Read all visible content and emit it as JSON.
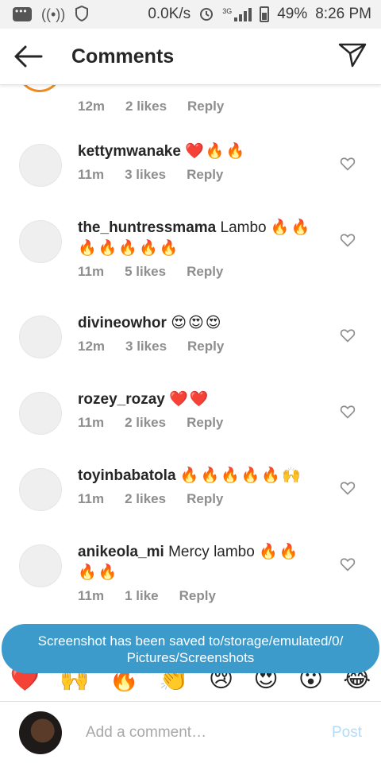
{
  "status_bar": {
    "speed": "0.0K/s",
    "network": "3G",
    "battery": "49%",
    "time": "8:26 PM"
  },
  "header": {
    "title": "Comments"
  },
  "partial_comment": {
    "time": "12m",
    "likes": "2 likes",
    "reply": "Reply"
  },
  "comments": [
    {
      "username": "kettymwanake",
      "text": "",
      "emoji": "❤️🔥🔥",
      "emoji2": "",
      "time": "11m",
      "likes": "3 likes",
      "reply": "Reply"
    },
    {
      "username": "the_huntressmama",
      "text": "Lambo",
      "emoji": "🔥🔥",
      "emoji2": "🔥🔥🔥🔥🔥",
      "time": "11m",
      "likes": "5 likes",
      "reply": "Reply"
    },
    {
      "username": "divineowhor",
      "text": "",
      "emoji": "😍😍😍",
      "emoji2": "",
      "time": "12m",
      "likes": "3 likes",
      "reply": "Reply"
    },
    {
      "username": "rozey_rozay",
      "text": "",
      "emoji": "❤️❤️",
      "emoji2": "",
      "time": "11m",
      "likes": "2 likes",
      "reply": "Reply"
    },
    {
      "username": "toyinbabatola",
      "text": "",
      "emoji": "🔥🔥🔥🔥🔥🙌",
      "emoji2": "",
      "time": "11m",
      "likes": "2 likes",
      "reply": "Reply"
    },
    {
      "username": "anikeola_mi",
      "text": "Mercy lambo",
      "emoji": "🔥🔥",
      "emoji2": "🔥🔥",
      "time": "11m",
      "likes": "1 like",
      "reply": "Reply"
    }
  ],
  "toast": {
    "line1": "Screenshot has been saved to/storage/emulated/0/",
    "line2": "Pictures/Screenshots"
  },
  "emoji_bar": [
    "❤️",
    "🙌",
    "🔥",
    "👏",
    "😢",
    "😍",
    "😮",
    "😂"
  ],
  "compose": {
    "placeholder": "Add a comment…",
    "post": "Post"
  }
}
